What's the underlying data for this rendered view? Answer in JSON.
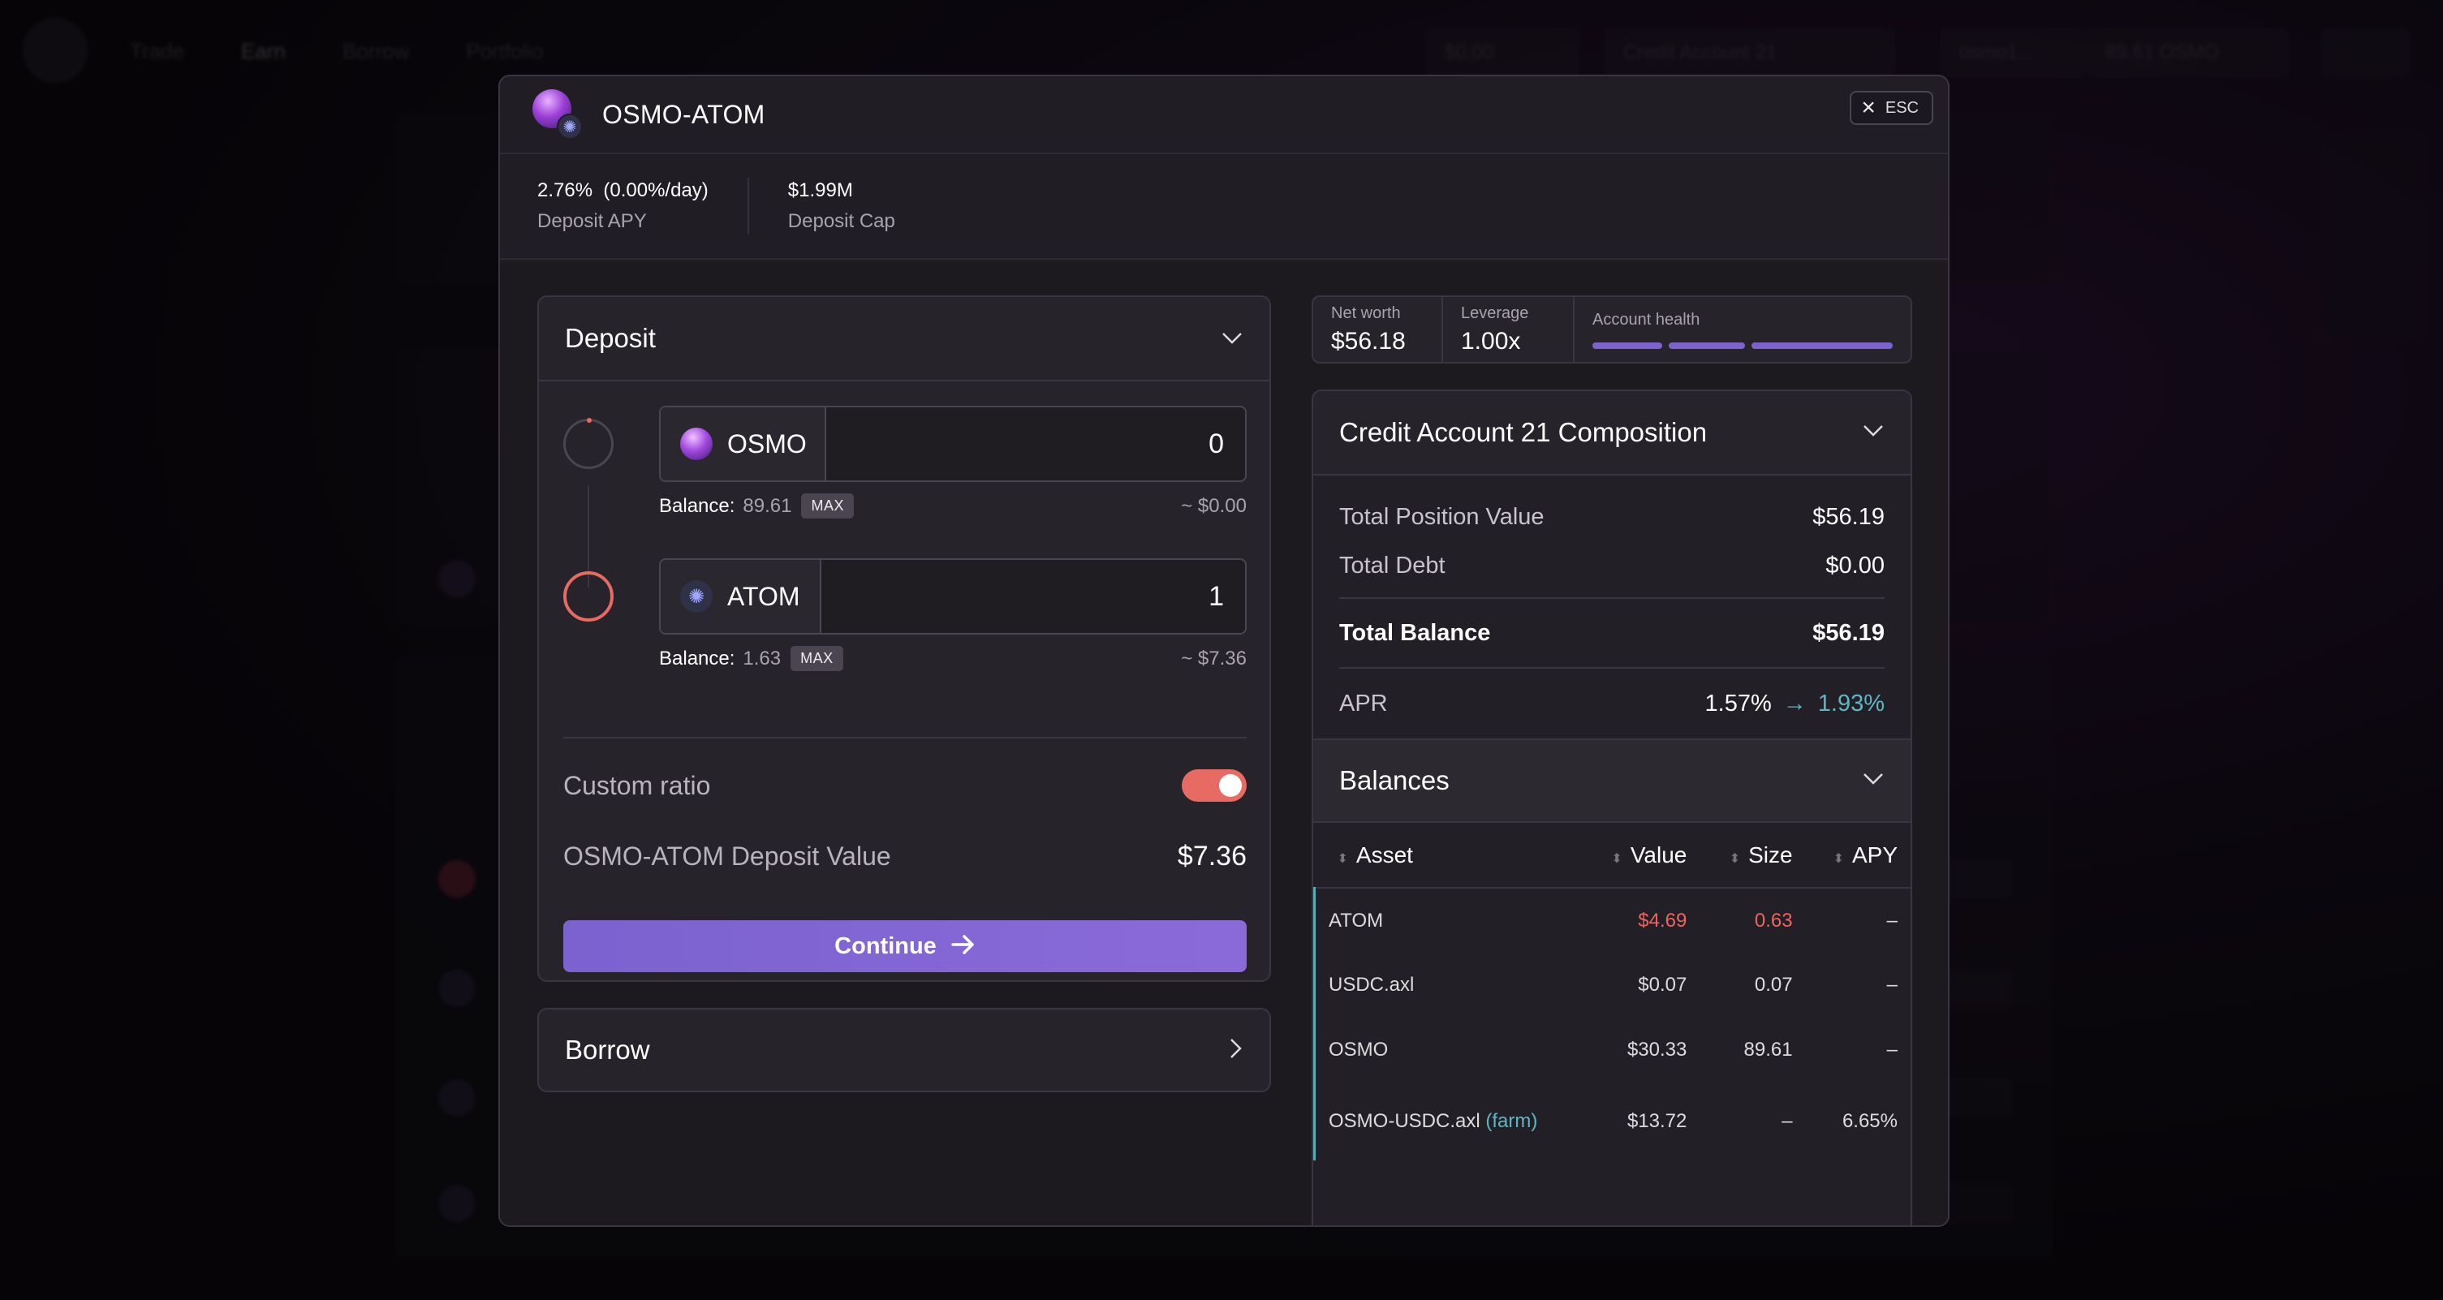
{
  "background": {
    "nav": [
      "Trade",
      "Earn",
      "Borrow",
      "Portfolio"
    ],
    "pills": [
      "$0.00",
      "Credit Account 21",
      "osmo1...",
      "89.61 OSMO"
    ]
  },
  "modal": {
    "title": "OSMO-ATOM",
    "esc_label": "ESC",
    "stats": {
      "apy_value": "2.76%  (0.00%/day)",
      "apy_label": "Deposit APY",
      "cap_value": "$1.99M",
      "cap_label": "Deposit Cap"
    },
    "deposit": {
      "title": "Deposit",
      "assets": [
        {
          "symbol": "OSMO",
          "amount": "0",
          "balance_label": "Balance:",
          "balance": "89.61",
          "max": "MAX",
          "usd": "~ $0.00"
        },
        {
          "symbol": "ATOM",
          "amount": "1",
          "balance_label": "Balance:",
          "balance": "1.63",
          "max": "MAX",
          "usd": "~ $7.36"
        }
      ],
      "custom_ratio_label": "Custom ratio",
      "custom_ratio_on": true,
      "deposit_value_label": "OSMO-ATOM Deposit Value",
      "deposit_value": "$7.36",
      "continue_label": "Continue"
    },
    "borrow": {
      "title": "Borrow"
    },
    "summary": {
      "net_worth_label": "Net worth",
      "net_worth": "$56.18",
      "leverage_label": "Leverage",
      "leverage": "1.00x",
      "health_label": "Account health"
    },
    "composition": {
      "title": "Credit Account 21 Composition",
      "total_position_label": "Total Position Value",
      "total_position": "$56.19",
      "total_debt_label": "Total Debt",
      "total_debt": "$0.00",
      "total_balance_label": "Total Balance",
      "total_balance": "$56.19",
      "apr_label": "APR",
      "apr_from": "1.57%",
      "apr_to": "1.93%"
    },
    "balances": {
      "title": "Balances",
      "columns": [
        "Asset",
        "Value",
        "Size",
        "APY"
      ],
      "rows": [
        {
          "asset": "ATOM",
          "value": "$4.69",
          "size": "0.63",
          "apy": "–",
          "negative": true
        },
        {
          "asset": "USDC.axl",
          "value": "$0.07",
          "size": "0.07",
          "apy": "–"
        },
        {
          "asset": "OSMO",
          "value": "$30.33",
          "size": "89.61",
          "apy": "–"
        },
        {
          "asset": "OSMO-USDC.axl",
          "asset_tag": "(farm)",
          "value": "$13.72",
          "size": "–",
          "apy": "6.65%"
        }
      ]
    }
  },
  "colors": {
    "accent": "#7b62cf",
    "warning": "#e86b63",
    "teal": "#5fb6c2",
    "negative": "#f0645f"
  }
}
